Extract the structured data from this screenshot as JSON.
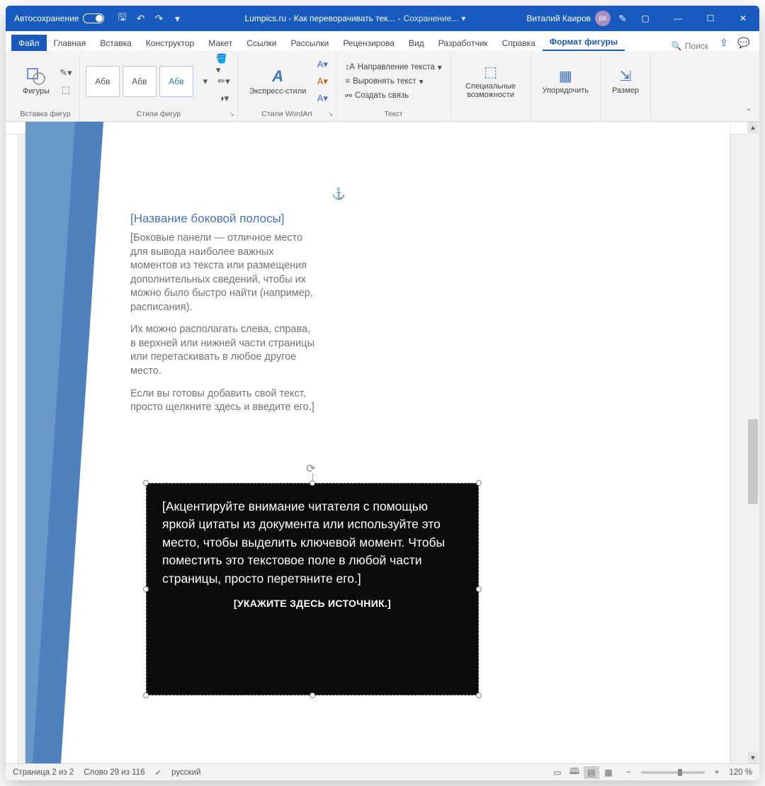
{
  "titlebar": {
    "autosave": "Автосохранение",
    "doc_title": "Lumpics.ru - Как переворачивать тек...",
    "saving": "Сохранение...",
    "user": "Виталий Каиров",
    "user_initials": "ВК"
  },
  "tabs": {
    "file": "Файл",
    "items": [
      "Главная",
      "Вставка",
      "Конструктор",
      "Макет",
      "Ссылки",
      "Рассылки",
      "Рецензирова",
      "Вид",
      "Разработчик",
      "Справка"
    ],
    "active": "Формат фигуры",
    "search": "Поиск"
  },
  "ribbon": {
    "shapes": {
      "btn": "Фигуры",
      "group": "Вставка фигур"
    },
    "styles": {
      "thumb": "Абв",
      "group": "Стили фигур"
    },
    "wordart": {
      "btn": "Экспресс-стили",
      "group": "Стили WordArt"
    },
    "text": {
      "dir": "Направление текста",
      "align": "Выровнять текст",
      "link": "Создать связь",
      "group": "Текст"
    },
    "a11y": {
      "btn": "Специальные возможности"
    },
    "arrange": {
      "btn": "Упорядочить"
    },
    "size": {
      "btn": "Размер"
    }
  },
  "document": {
    "sidebar_title": "[Название боковой полосы]",
    "sidebar_p1": "[Боковые панели — отличное место для вывода наиболее важных моментов из текста или размещения дополнительных сведений, чтобы их можно было быстро найти (например, расписания).",
    "sidebar_p2": "Их можно располагать слева, справа, в верхней или нижней части страницы или перетаскивать в любое другое место.",
    "sidebar_p3": "Если вы готовы добавить свой текст, просто щелкните здесь и введите его.]",
    "quote": "[Акцентируйте внимание читателя с помощью яркой цитаты из документа или используйте это место, чтобы выделить ключевой момент. Чтобы поместить это текстовое поле в любой части страницы, просто перетяните его.]",
    "quote_source": "[УКАЖИТЕ ЗДЕСЬ ИСТОЧНИК.]"
  },
  "statusbar": {
    "page": "Страница 2 из 2",
    "words": "Слово 29 из 116",
    "lang": "русский",
    "zoom": "120 %"
  }
}
